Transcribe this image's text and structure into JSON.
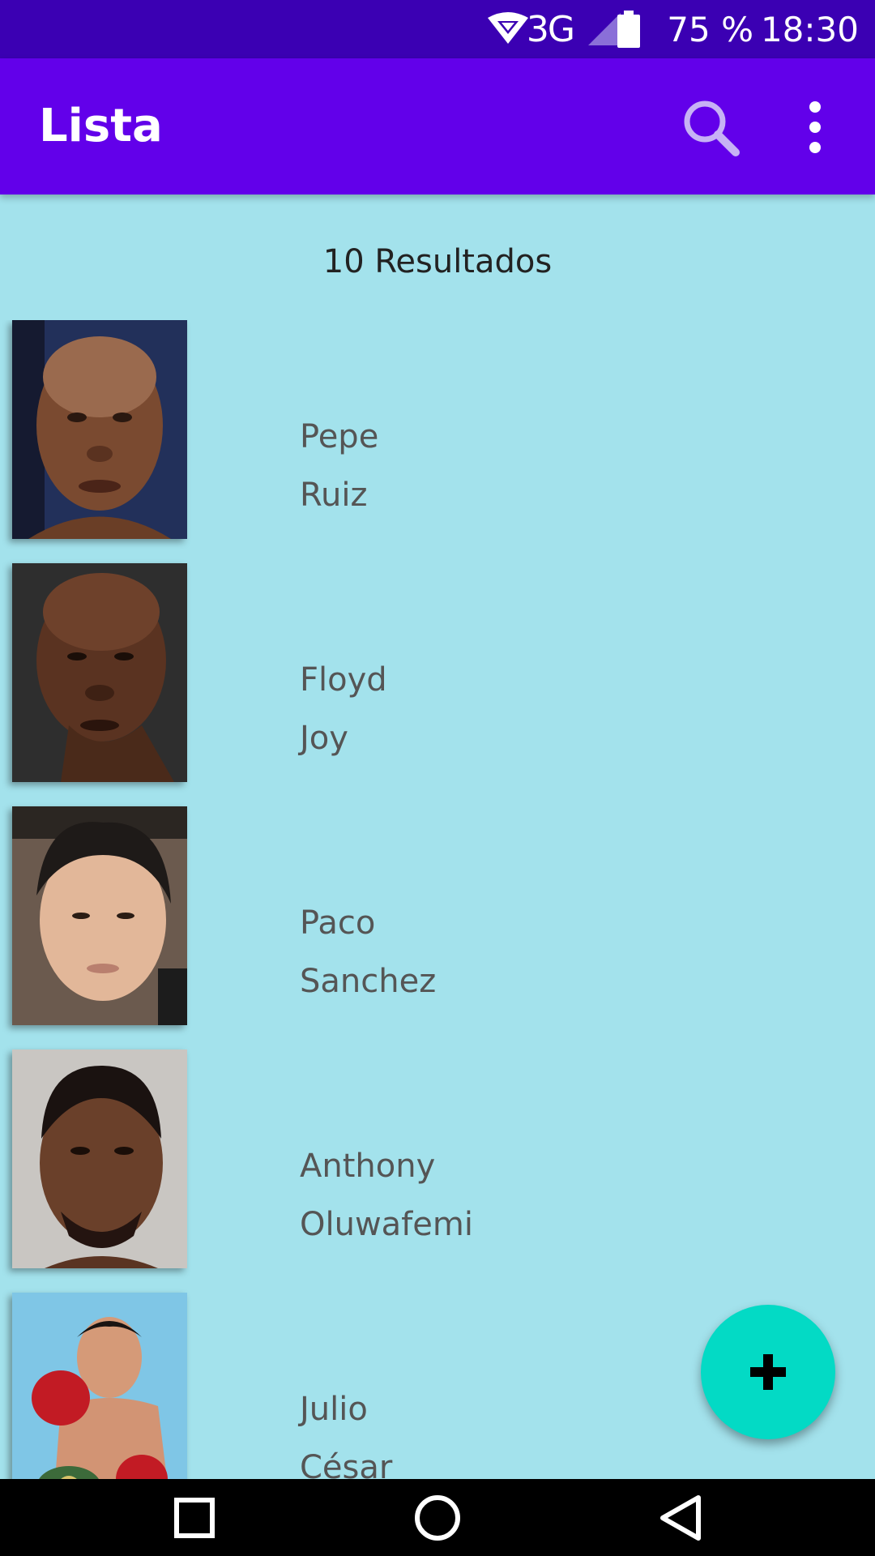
{
  "status_bar": {
    "network": "3G",
    "battery": "75 %",
    "time": "18:30",
    "icons": [
      "wifi-icon",
      "signal-icon",
      "battery-icon"
    ]
  },
  "app_bar": {
    "title": "Lista",
    "icons": [
      "search-icon",
      "more-vert-icon"
    ]
  },
  "results_label": "10 Resultados",
  "contacts": [
    {
      "first": "Pepe",
      "last": "Ruiz"
    },
    {
      "first": "Floyd",
      "last": "Joy"
    },
    {
      "first": "Paco",
      "last": "Sanchez"
    },
    {
      "first": "Anthony",
      "last": "Oluwafemi"
    },
    {
      "first": "Julio",
      "last": "César"
    }
  ],
  "fab": {
    "icon": "plus-icon"
  },
  "nav_bar": {
    "icons": [
      "recents-square-icon",
      "home-circle-icon",
      "back-triangle-icon"
    ]
  },
  "colors": {
    "status_bar": "#3b00b3",
    "app_bar": "#6200ea",
    "background": "#a3e2ec",
    "fab": "#03dac5"
  }
}
